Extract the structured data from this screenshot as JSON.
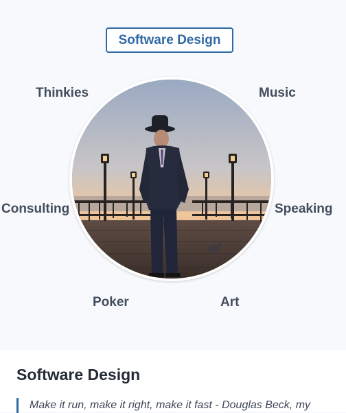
{
  "hero": {
    "active_topic": "Software Design",
    "topics": {
      "thinkies": "Thinkies",
      "music": "Music",
      "consulting": "Consulting",
      "speaking": "Speaking",
      "poker": "Poker",
      "art": "Art"
    },
    "photo_icon": "portrait-photo"
  },
  "section": {
    "title": "Software Design",
    "quote": "Make it run, make it right, make it fast - Douglas Beck, my"
  },
  "colors": {
    "accent": "#2f69a6",
    "page_background": "#f7f9fc",
    "label_text": "#434c5c"
  }
}
